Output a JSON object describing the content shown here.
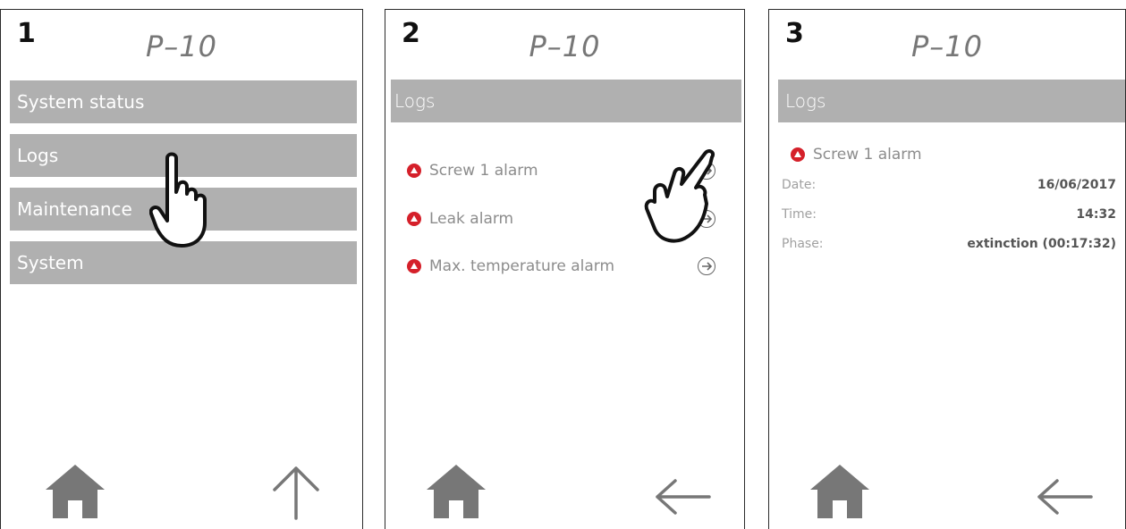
{
  "panels": [
    {
      "step": "1",
      "title": "P–10",
      "menu": [
        "System status",
        "Logs",
        "Maintenance",
        "System"
      ]
    },
    {
      "step": "2",
      "title": "P–10",
      "header": "Logs",
      "alarms": [
        "Screw 1 alarm",
        "Leak alarm",
        "Max. temperature alarm"
      ]
    },
    {
      "step": "3",
      "title": "P–10",
      "header": "Logs",
      "alarm": "Screw 1 alarm",
      "details": [
        {
          "key": "Date:",
          "value": "16/06/2017"
        },
        {
          "key": "Time:",
          "value": "14:32"
        },
        {
          "key": "Phase:",
          "value": "extinction (00:17:32)"
        }
      ]
    }
  ],
  "icons": {
    "home": "home-icon",
    "up": "up-arrow-icon",
    "back": "back-arrow-icon",
    "pointer": "hand-pointer-icon",
    "alarm": "alarm-icon",
    "forward": "arrow-circle-right-icon"
  },
  "colors": {
    "menu_bg": "#b0b0b0",
    "alarm_red": "#d5202a",
    "nav_gray": "#777777"
  }
}
